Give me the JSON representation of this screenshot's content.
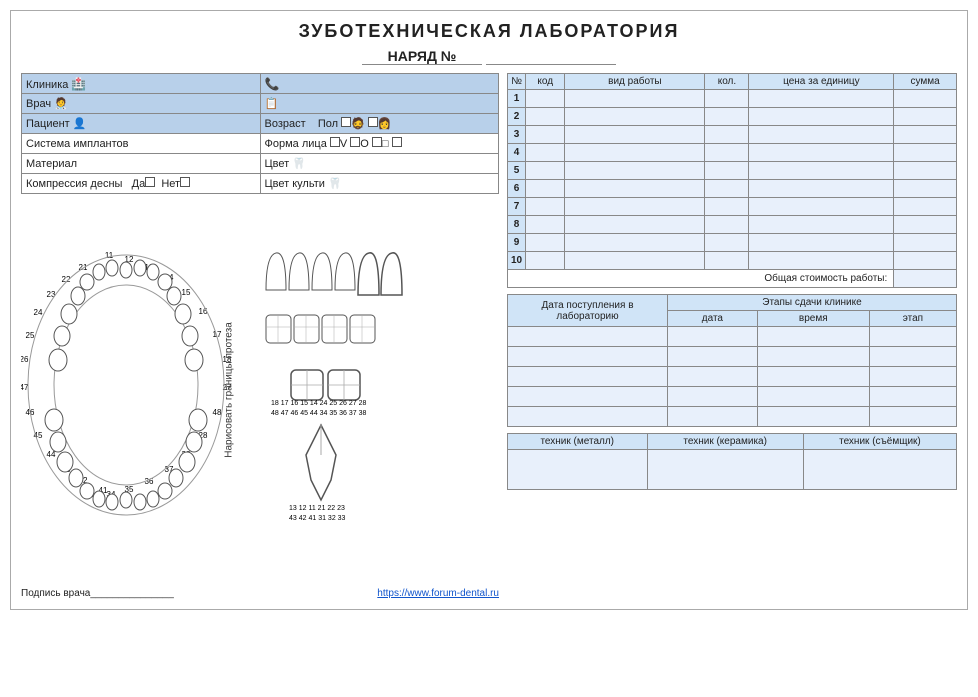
{
  "title": "ЗУБОТЕХНИЧЕСКАЯ ЛАБОРАТОРИЯ",
  "subtitle": "НАРЯД №",
  "narad_number": "_______________",
  "fields": {
    "clinic_label": "Клиника",
    "doctor_label": "Врач",
    "patient_label": "Пациент",
    "age_label": "Возраст",
    "gender_label": "Пол",
    "implant_label": "Система имплантов",
    "face_label": "Форма лица",
    "material_label": "Материал",
    "color_label": "Цвет",
    "compression_label": "Компрессия десны",
    "yes_label": "Да",
    "no_label": "Нет",
    "color_cult_label": "Цвет культи"
  },
  "work_table": {
    "headers": [
      "№",
      "код",
      "вид работы",
      "кол.",
      "цена за единицу",
      "сумма"
    ],
    "rows": [
      1,
      2,
      3,
      4,
      5,
      6,
      7,
      8,
      9,
      10
    ],
    "total_label": "Общая стоимость работы:"
  },
  "schedule_table": {
    "col1_header": "Дата поступления в лабораторию",
    "col2_header": "Этапы сдачи клинике",
    "sub_headers": [
      "дата",
      "время",
      "этап"
    ],
    "rows": 5
  },
  "tech_table": {
    "headers": [
      "техник (металл)",
      "техник (керамика)",
      "техник (съёмщик)"
    ]
  },
  "diagram": {
    "rotate_label": "Нарисовать границы протеза",
    "tooth_numbers_upper": "18 17 16 15 14 24 25 26 27 28\n48 47 46 45 44 34 35 36 37 38",
    "tooth_numbers_lower": "13 12 11 21 22 23\n43 42 41 31 32 33"
  },
  "signature": {
    "label": "Подпись врача_______________",
    "link_text": "https://www.forum-dental.ru",
    "link_url": "https://www.forum-dental.ru"
  }
}
